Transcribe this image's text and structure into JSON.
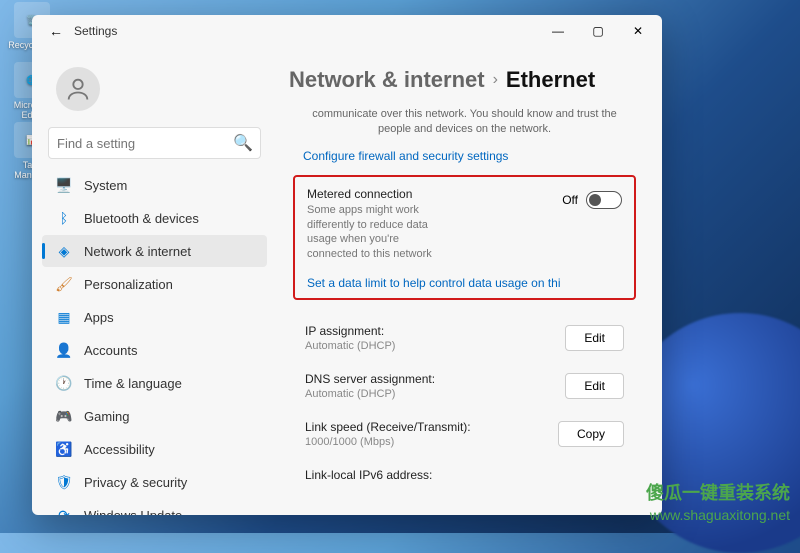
{
  "desktop": {
    "icons": [
      "Recycle Bin",
      "Microsoft Edge",
      "Task Manager"
    ]
  },
  "window": {
    "title": "Settings"
  },
  "search": {
    "placeholder": "Find a setting"
  },
  "sidebar": {
    "items": [
      {
        "label": "System",
        "icon": "🖥️",
        "color": "#0078d4"
      },
      {
        "label": "Bluetooth & devices",
        "icon": "ᛒ",
        "color": "#0078d4"
      },
      {
        "label": "Network & internet",
        "icon": "◈",
        "color": "#0078d4"
      },
      {
        "label": "Personalization",
        "icon": "🖌",
        "color": "#d08030"
      },
      {
        "label": "Apps",
        "icon": "▦",
        "color": "#0078d4"
      },
      {
        "label": "Accounts",
        "icon": "👤",
        "color": "#555"
      },
      {
        "label": "Time & language",
        "icon": "🕐",
        "color": "#555"
      },
      {
        "label": "Gaming",
        "icon": "🎮",
        "color": "#555"
      },
      {
        "label": "Accessibility",
        "icon": "♿",
        "color": "#0078d4"
      },
      {
        "label": "Privacy & security",
        "icon": "🛡",
        "color": "#0078d4"
      },
      {
        "label": "Windows Update",
        "icon": "⟳",
        "color": "#0078d4"
      }
    ]
  },
  "breadcrumb": {
    "parent": "Network & internet",
    "current": "Ethernet"
  },
  "notice": {
    "text": "communicate over this network. You should know and trust the people and devices on the network.",
    "link": "Configure firewall and security settings"
  },
  "metered": {
    "title": "Metered connection",
    "desc": "Some apps might work differently to reduce data usage when you're connected to this network",
    "state": "Off",
    "link": "Set a data limit to help control data usage on thi"
  },
  "settings": [
    {
      "title": "IP assignment:",
      "value": "Automatic (DHCP)",
      "action": "Edit"
    },
    {
      "title": "DNS server assignment:",
      "value": "Automatic (DHCP)",
      "action": "Edit"
    },
    {
      "title": "Link speed (Receive/Transmit):",
      "value": "1000/1000 (Mbps)",
      "action": "Copy"
    },
    {
      "title": "Link-local IPv6 address:",
      "value": "",
      "action": ""
    }
  ],
  "watermark": {
    "line1": "傻瓜一键重装系统",
    "line2": "www.shaguaxitong.net"
  }
}
